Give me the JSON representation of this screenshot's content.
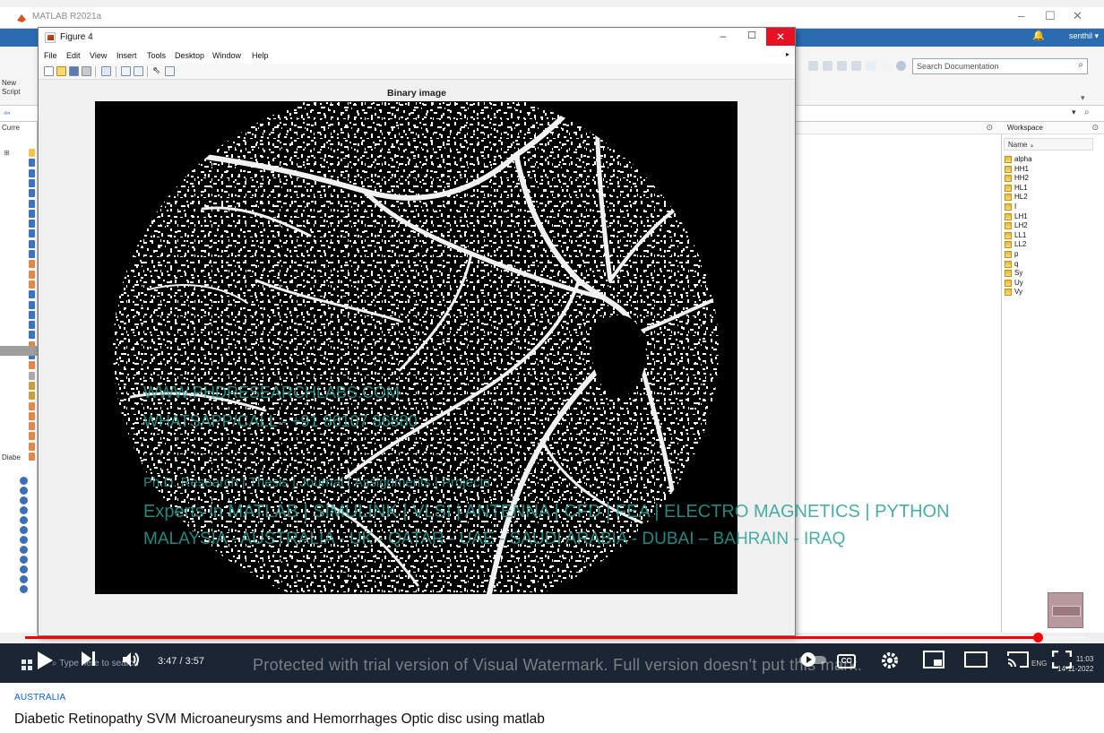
{
  "matlab": {
    "window_title": "MATLAB R2021a",
    "search_placeholder": "Search Documentation",
    "user_name": "senthil",
    "ribbon_new_label": "New",
    "ribbon_script_label": "Script",
    "current_folder_label": "Curre",
    "details_label": "Diabe"
  },
  "figure": {
    "title": "Figure 4",
    "menu": [
      "File",
      "Edit",
      "View",
      "Insert",
      "Tools",
      "Desktop",
      "Window",
      "Help"
    ],
    "axes_title": "Binary image"
  },
  "workspace": {
    "title": "Workspace",
    "column_name": "Name",
    "sort_indicator": "▲",
    "variables": [
      "alpha",
      "HH1",
      "HH2",
      "HL1",
      "HL2",
      "I",
      "LH1",
      "LH2",
      "LL1",
      "LL2",
      "p",
      "q",
      "Sy",
      "Uy",
      "Vy"
    ]
  },
  "watermark": {
    "website": "WWW.PHDRESEARCHLABS.COM",
    "whatsapp": "WHATSAPP/CALL - +91 86107 86880",
    "services": "Ph.D. Research | Thesis | Journal | Assignments | Projects",
    "experts": "Experts in MATLAB | SIMULINK | VLSI | ANTENNA | CFD | FEA | ELECTRO MAGNETICS | PYTHON",
    "countries": "MALAYSIA - AUSTRALIA - UK - QATAR - UAE - SAUDI ARABIA - DUBAI – BAHRAIN - IRAQ",
    "visual_watermark": "Protected with trial version of Visual Watermark. Full version doesn't put this mark."
  },
  "taskbar": {
    "search_placeholder": "Type here to search",
    "clock_time": "11:03",
    "clock_date": "14-11-2022",
    "lang": "ENG"
  },
  "player": {
    "current_time": "3:47",
    "duration": "3:57",
    "time_display": "3:47 / 3:57",
    "progress_fraction": 0.953,
    "cc_label": "CC",
    "accent_color": "#ff0000"
  },
  "video": {
    "location": "AUSTRALIA",
    "title": "Diabetic Retinopathy SVM Microaneurysms and Hemorrhages Optic disc using matlab"
  },
  "icons": [
    "play-icon",
    "next-icon",
    "volume-icon",
    "settings-icon",
    "miniplayer-icon",
    "theater-icon",
    "cast-icon",
    "fullscreen-icon",
    "search-icon",
    "bell-icon",
    "close-icon",
    "minimize-icon",
    "maximize-icon",
    "windows-icon"
  ]
}
